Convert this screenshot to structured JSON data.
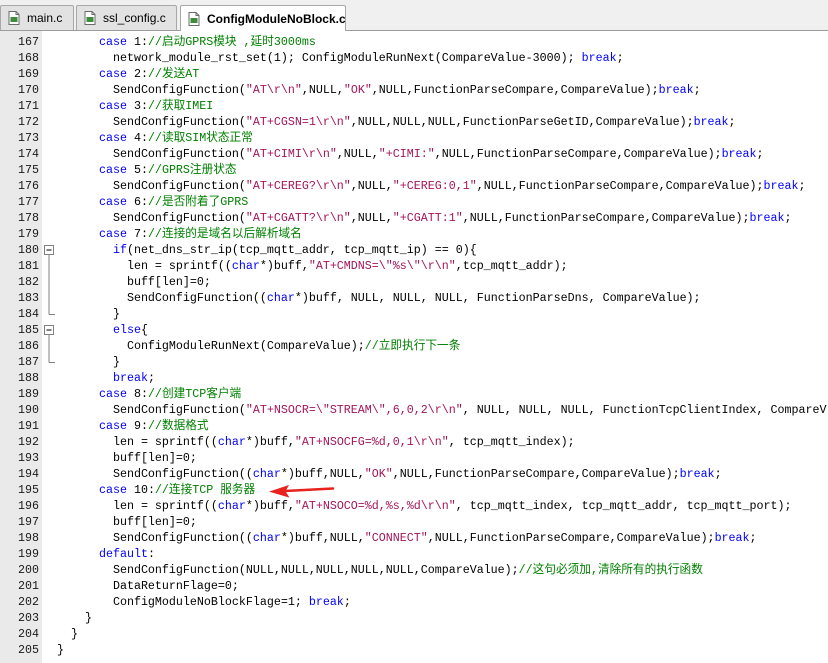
{
  "tabs": [
    {
      "label": "main.c",
      "icon": "c-file-icon",
      "active": false
    },
    {
      "label": "ssl_config.c",
      "icon": "c-file-icon",
      "active": false
    },
    {
      "label": "ConfigModuleNoBlock.c",
      "icon": "c-file-icon",
      "active": true
    }
  ],
  "theme": {
    "text": "#000000",
    "keyword": "#0000FF",
    "comment": "#008000",
    "string": "#A3155A",
    "annotation_arrow": "#E8231D"
  },
  "editor": {
    "lines": [
      {
        "num": "167",
        "tokens": [
          {
            "t": "      case",
            "color": "#0000FF"
          },
          {
            "t": " 1:"
          },
          {
            "t": "//启动GPRS模块 ,延时3000ms",
            "color": "#008000"
          }
        ]
      },
      {
        "num": "168",
        "tokens": [
          {
            "t": "        network_module_rst_set(1); ConfigModuleRunNext(CompareValue-3000); "
          },
          {
            "t": "break",
            "color": "#0000FF"
          },
          {
            "t": ";"
          }
        ]
      },
      {
        "num": "169",
        "tokens": [
          {
            "t": "      case",
            "color": "#0000FF"
          },
          {
            "t": " 2:"
          },
          {
            "t": "//发送AT",
            "color": "#008000"
          }
        ]
      },
      {
        "num": "170",
        "tokens": [
          {
            "t": "        SendConfigFunction("
          },
          {
            "t": "\"AT\\r\\n\"",
            "color": "#A3155A"
          },
          {
            "t": ",NULL,"
          },
          {
            "t": "\"OK\"",
            "color": "#A3155A"
          },
          {
            "t": ",NULL,FunctionParseCompare,CompareValue);"
          },
          {
            "t": "break",
            "color": "#0000FF"
          },
          {
            "t": ";"
          }
        ]
      },
      {
        "num": "171",
        "tokens": [
          {
            "t": "      case",
            "color": "#0000FF"
          },
          {
            "t": " 3:"
          },
          {
            "t": "//获取IMEI",
            "color": "#008000"
          }
        ]
      },
      {
        "num": "172",
        "tokens": [
          {
            "t": "        SendConfigFunction("
          },
          {
            "t": "\"AT+CGSN=1\\r\\n\"",
            "color": "#A3155A"
          },
          {
            "t": ",NULL,NULL,NULL,FunctionParseGetID,CompareValue);"
          },
          {
            "t": "break",
            "color": "#0000FF"
          },
          {
            "t": ";"
          }
        ]
      },
      {
        "num": "173",
        "tokens": [
          {
            "t": "      case",
            "color": "#0000FF"
          },
          {
            "t": " 4:"
          },
          {
            "t": "//读取SIM状态正常",
            "color": "#008000"
          }
        ]
      },
      {
        "num": "174",
        "tokens": [
          {
            "t": "        SendConfigFunction("
          },
          {
            "t": "\"AT+CIMI\\r\\n\"",
            "color": "#A3155A"
          },
          {
            "t": ",NULL,"
          },
          {
            "t": "\"+CIMI:\"",
            "color": "#A3155A"
          },
          {
            "t": ",NULL,FunctionParseCompare,CompareValue);"
          },
          {
            "t": "break",
            "color": "#0000FF"
          },
          {
            "t": ";"
          }
        ]
      },
      {
        "num": "175",
        "tokens": [
          {
            "t": "      case",
            "color": "#0000FF"
          },
          {
            "t": " 5:"
          },
          {
            "t": "//GPRS注册状态",
            "color": "#008000"
          }
        ]
      },
      {
        "num": "176",
        "tokens": [
          {
            "t": "        SendConfigFunction("
          },
          {
            "t": "\"AT+CEREG?\\r\\n\"",
            "color": "#A3155A"
          },
          {
            "t": ",NULL,"
          },
          {
            "t": "\"+CEREG:0,1\"",
            "color": "#A3155A"
          },
          {
            "t": ",NULL,FunctionParseCompare,CompareValue);"
          },
          {
            "t": "break",
            "color": "#0000FF"
          },
          {
            "t": ";"
          }
        ]
      },
      {
        "num": "177",
        "tokens": [
          {
            "t": "      case",
            "color": "#0000FF"
          },
          {
            "t": " 6:"
          },
          {
            "t": "//是否附着了GPRS",
            "color": "#008000"
          }
        ]
      },
      {
        "num": "178",
        "tokens": [
          {
            "t": "        SendConfigFunction("
          },
          {
            "t": "\"AT+CGATT?\\r\\n\"",
            "color": "#A3155A"
          },
          {
            "t": ",NULL,"
          },
          {
            "t": "\"+CGATT:1\"",
            "color": "#A3155A"
          },
          {
            "t": ",NULL,FunctionParseCompare,CompareValue);"
          },
          {
            "t": "break",
            "color": "#0000FF"
          },
          {
            "t": ";"
          }
        ]
      },
      {
        "num": "179",
        "tokens": [
          {
            "t": "      case",
            "color": "#0000FF"
          },
          {
            "t": " 7:"
          },
          {
            "t": "//连接的是域名以后解析域名",
            "color": "#008000"
          }
        ]
      },
      {
        "num": "180",
        "tokens": [
          {
            "t": "        if",
            "color": "#0000FF"
          },
          {
            "t": "(net_dns_str_ip(tcp_mqtt_addr, tcp_mqtt_ip) == 0){"
          }
        ]
      },
      {
        "num": "181",
        "tokens": [
          {
            "t": "          len = sprintf(("
          },
          {
            "t": "char",
            "color": "#0000FF"
          },
          {
            "t": "*)buff,"
          },
          {
            "t": "\"AT+CMDNS=\\\"%s\\\"\\r\\n\"",
            "color": "#A3155A"
          },
          {
            "t": ",tcp_mqtt_addr);"
          }
        ]
      },
      {
        "num": "182",
        "tokens": [
          {
            "t": "          buff[len]=0;"
          }
        ]
      },
      {
        "num": "183",
        "tokens": [
          {
            "t": "          SendConfigFunction(("
          },
          {
            "t": "char",
            "color": "#0000FF"
          },
          {
            "t": "*)buff, NULL, NULL, NULL, FunctionParseDns, CompareValue);"
          }
        ]
      },
      {
        "num": "184",
        "tokens": [
          {
            "t": "        }"
          }
        ]
      },
      {
        "num": "185",
        "tokens": [
          {
            "t": "        else",
            "color": "#0000FF"
          },
          {
            "t": "{"
          }
        ]
      },
      {
        "num": "186",
        "tokens": [
          {
            "t": "          ConfigModuleRunNext(CompareValue);"
          },
          {
            "t": "//立即执行下一条",
            "color": "#008000"
          }
        ]
      },
      {
        "num": "187",
        "tokens": [
          {
            "t": "        }"
          }
        ]
      },
      {
        "num": "188",
        "tokens": [
          {
            "t": "        break",
            "color": "#0000FF"
          },
          {
            "t": ";"
          }
        ]
      },
      {
        "num": "189",
        "tokens": [
          {
            "t": "      case",
            "color": "#0000FF"
          },
          {
            "t": " 8:"
          },
          {
            "t": "//创建TCP客户端",
            "color": "#008000"
          }
        ]
      },
      {
        "num": "190",
        "tokens": [
          {
            "t": "        SendConfigFunction("
          },
          {
            "t": "\"AT+NSOCR=\\\"STREAM\\\",6,0,2\\r\\n\"",
            "color": "#A3155A"
          },
          {
            "t": ", NULL, NULL, NULL, FunctionTcpClientIndex, CompareV"
          }
        ]
      },
      {
        "num": "191",
        "tokens": [
          {
            "t": "      case",
            "color": "#0000FF"
          },
          {
            "t": " 9:"
          },
          {
            "t": "//数据格式",
            "color": "#008000"
          }
        ]
      },
      {
        "num": "192",
        "tokens": [
          {
            "t": "        len = sprintf(("
          },
          {
            "t": "char",
            "color": "#0000FF"
          },
          {
            "t": "*)buff,"
          },
          {
            "t": "\"AT+NSOCFG=%d,0,1\\r\\n\"",
            "color": "#A3155A"
          },
          {
            "t": ", tcp_mqtt_index);"
          }
        ]
      },
      {
        "num": "193",
        "tokens": [
          {
            "t": "        buff[len]=0;"
          }
        ]
      },
      {
        "num": "194",
        "tokens": [
          {
            "t": "        SendConfigFunction(("
          },
          {
            "t": "char",
            "color": "#0000FF"
          },
          {
            "t": "*)buff,NULL,"
          },
          {
            "t": "\"OK\"",
            "color": "#A3155A"
          },
          {
            "t": ",NULL,FunctionParseCompare,CompareValue);"
          },
          {
            "t": "break",
            "color": "#0000FF"
          },
          {
            "t": ";"
          }
        ]
      },
      {
        "num": "195",
        "tokens": [
          {
            "t": "      case",
            "color": "#0000FF"
          },
          {
            "t": " 10:"
          },
          {
            "t": "//连接TCP 服务器",
            "color": "#008000"
          }
        ]
      },
      {
        "num": "196",
        "tokens": [
          {
            "t": "        len = sprintf(("
          },
          {
            "t": "char",
            "color": "#0000FF"
          },
          {
            "t": "*)buff,"
          },
          {
            "t": "\"AT+NSOCO=%d,%s,%d\\r\\n\"",
            "color": "#A3155A"
          },
          {
            "t": ", tcp_mqtt_index, tcp_mqtt_addr, tcp_mqtt_port);"
          }
        ]
      },
      {
        "num": "197",
        "tokens": [
          {
            "t": "        buff[len]=0;"
          }
        ]
      },
      {
        "num": "198",
        "tokens": [
          {
            "t": "        SendConfigFunction(("
          },
          {
            "t": "char",
            "color": "#0000FF"
          },
          {
            "t": "*)buff,NULL,"
          },
          {
            "t": "\"CONNECT\"",
            "color": "#A3155A"
          },
          {
            "t": ",NULL,FunctionParseCompare,CompareValue);"
          },
          {
            "t": "break",
            "color": "#0000FF"
          },
          {
            "t": ";"
          }
        ]
      },
      {
        "num": "199",
        "tokens": [
          {
            "t": "      default",
            "color": "#0000FF"
          },
          {
            "t": ":"
          }
        ]
      },
      {
        "num": "200",
        "tokens": [
          {
            "t": "        SendConfigFunction(NULL,NULL,NULL,NULL,NULL,CompareValue);"
          },
          {
            "t": "//这句必须加,清除所有的执行函数",
            "color": "#008000"
          }
        ]
      },
      {
        "num": "201",
        "tokens": [
          {
            "t": "        DataReturnFlage=0;"
          }
        ]
      },
      {
        "num": "202",
        "tokens": [
          {
            "t": "        ConfigModuleNoBlockFlage=1; "
          },
          {
            "t": "break",
            "color": "#0000FF"
          },
          {
            "t": ";"
          }
        ]
      },
      {
        "num": "203",
        "tokens": [
          {
            "t": "    }"
          }
        ]
      },
      {
        "num": "204",
        "tokens": [
          {
            "t": "  }"
          }
        ]
      },
      {
        "num": "205",
        "tokens": [
          {
            "t": "}"
          }
        ]
      }
    ]
  }
}
